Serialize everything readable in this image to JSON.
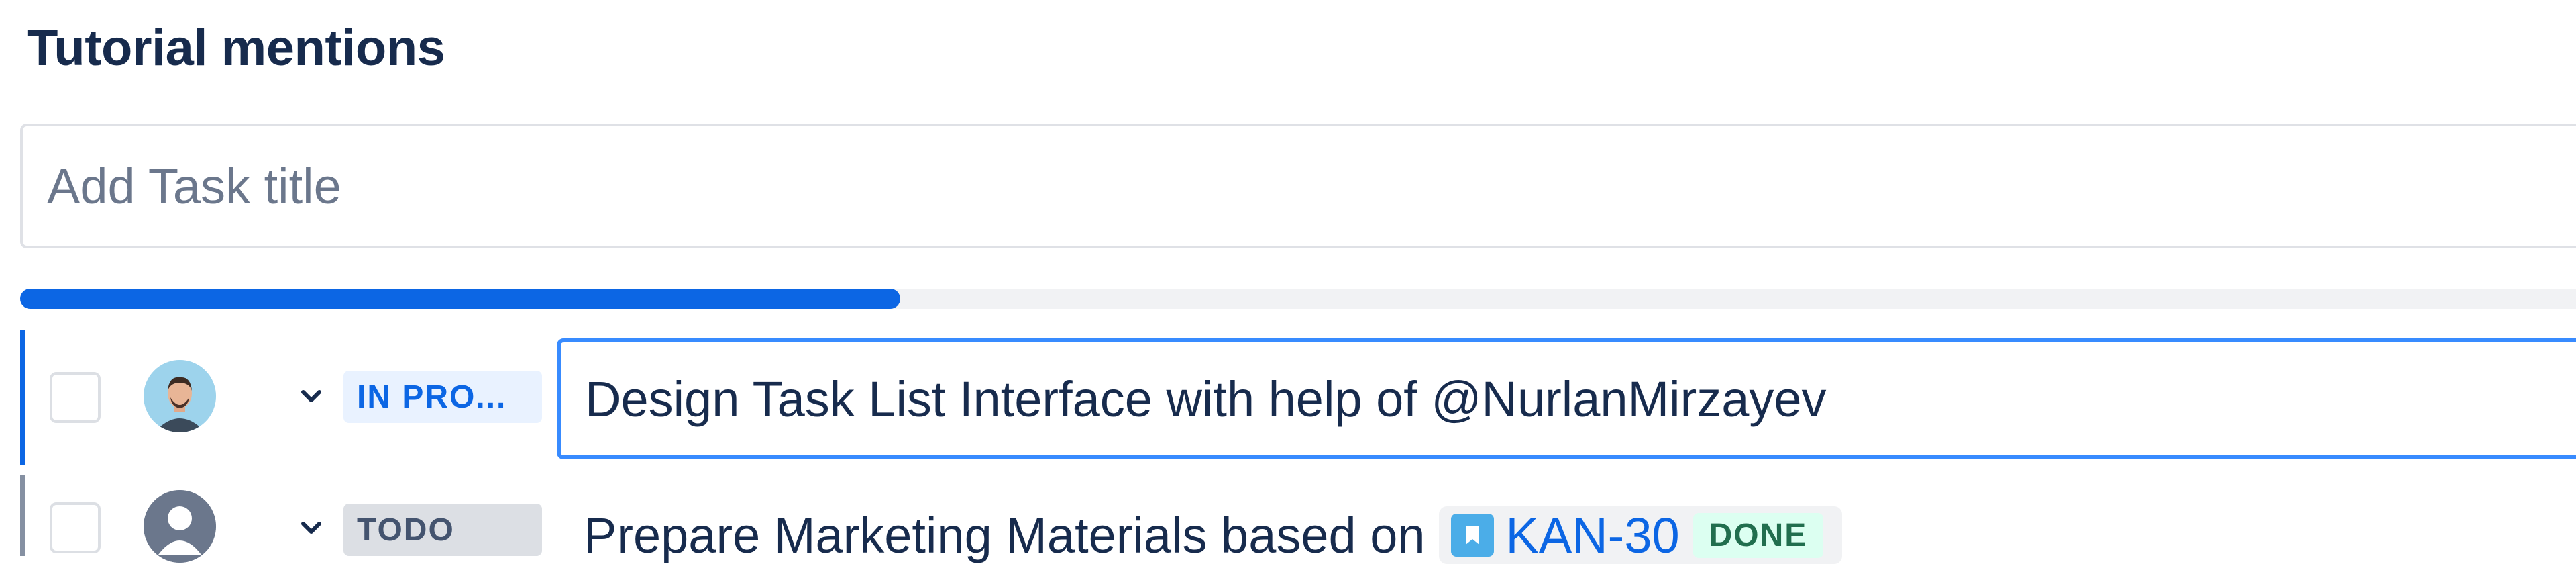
{
  "panel": {
    "title": "Tutorial mentions"
  },
  "new_task": {
    "placeholder": "Add Task title",
    "value": ""
  },
  "progress": {
    "percent": 34
  },
  "tasks": [
    {
      "status": "IN PROGRESS",
      "status_display": "IN PRO...",
      "title": "Design Task List Interface with help of @NurlanMirzayev",
      "avatar": "person-avatar-icon",
      "editing": true
    },
    {
      "status": "TODO",
      "status_display": "TODO",
      "title_prefix": "Prepare Marketing Materials based on",
      "linked_issue": {
        "key": "KAN-30",
        "status": "DONE",
        "icon": "story-icon"
      },
      "avatar": "default-user-icon",
      "editing": false
    }
  ],
  "colors": {
    "accent": "#0c66e4",
    "focus_border": "#388bff",
    "heading": "#172b4d",
    "done_bg": "#dcfff1",
    "done_text": "#216e4e"
  }
}
